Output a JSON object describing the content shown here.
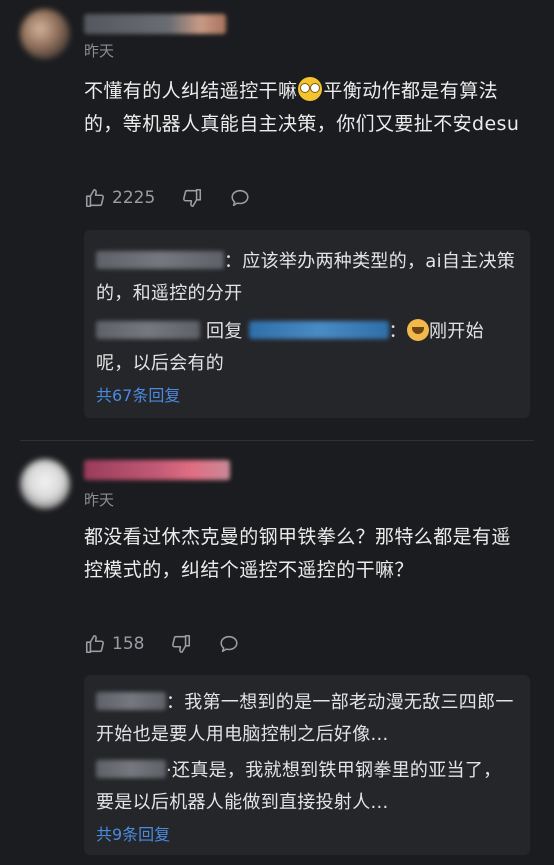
{
  "comments": [
    {
      "date": "昨天",
      "text_before_emoji": "不懂有的人纠结遥控干嘛",
      "text_after_emoji": "平衡动作都是有算法的，等机器人真能自主决策，你们又要扯不安desu",
      "like_count": "2225",
      "replies": [
        {
          "text": "：应该举办两种类型的，ai自主决策的，和遥控的分开"
        },
        {
          "reply_word": "回复",
          "text_before_emoji": "：",
          "text_after_emoji": "刚开始呢，以后会有的"
        }
      ],
      "more_replies_label": "共67条回复"
    },
    {
      "date": "昨天",
      "text": "都没看过休杰克曼的钢甲铁拳么？那特么都是有遥控模式的，纠结个遥控不遥控的干嘛？",
      "like_count": "158",
      "replies": [
        {
          "text": "：我第一想到的是一部老动漫无敌三四郎一开始也是要人用电脑控制之后好像..."
        },
        {
          "text": "·还真是，我就想到铁甲钢拳里的亚当了，要是以后机器人能做到直接投射人..."
        }
      ],
      "more_replies_label": "共9条回复"
    }
  ],
  "icons": {
    "like": "thumbs-up-icon",
    "dislike": "thumbs-down-icon",
    "comment": "comment-bubble-icon"
  },
  "colors": {
    "background": "#1b1c1f",
    "reply_box": "#25262a",
    "link": "#4a8ae0",
    "muted": "#8a8d92"
  }
}
